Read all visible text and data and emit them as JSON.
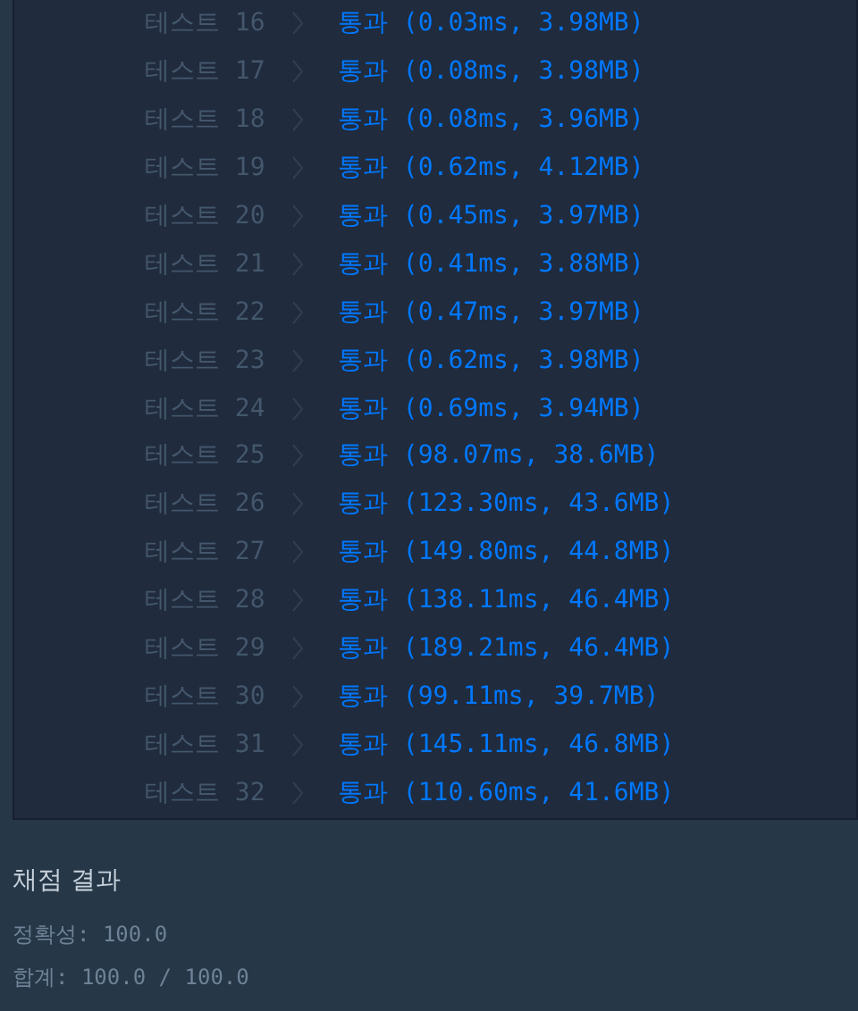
{
  "tests": [
    {
      "label": "테스트 16",
      "result": "통과 (0.03ms, 3.98MB)",
      "passed": true
    },
    {
      "label": "테스트 17",
      "result": "통과 (0.08ms, 3.98MB)",
      "passed": true
    },
    {
      "label": "테스트 18",
      "result": "통과 (0.08ms, 3.96MB)",
      "passed": true
    },
    {
      "label": "테스트 19",
      "result": "통과 (0.62ms, 4.12MB)",
      "passed": true
    },
    {
      "label": "테스트 20",
      "result": "통과 (0.45ms, 3.97MB)",
      "passed": true
    },
    {
      "label": "테스트 21",
      "result": "통과 (0.41ms, 3.88MB)",
      "passed": true
    },
    {
      "label": "테스트 22",
      "result": "통과 (0.47ms, 3.97MB)",
      "passed": true
    },
    {
      "label": "테스트 23",
      "result": "통과 (0.62ms, 3.98MB)",
      "passed": true
    },
    {
      "label": "테스트 24",
      "result": "통과 (0.69ms, 3.94MB)",
      "passed": true
    },
    {
      "label": "테스트 25",
      "result": "통과 (98.07ms, 38.6MB)",
      "passed": true
    },
    {
      "label": "테스트 26",
      "result": "통과 (123.30ms, 43.6MB)",
      "passed": true
    },
    {
      "label": "테스트 27",
      "result": "통과 (149.80ms, 44.8MB)",
      "passed": true
    },
    {
      "label": "테스트 28",
      "result": "통과 (138.11ms, 46.4MB)",
      "passed": true
    },
    {
      "label": "테스트 29",
      "result": "통과 (189.21ms, 46.4MB)",
      "passed": true
    },
    {
      "label": "테스트 30",
      "result": "통과 (99.11ms, 39.7MB)",
      "passed": true
    },
    {
      "label": "테스트 31",
      "result": "통과 (145.11ms, 46.8MB)",
      "passed": true
    },
    {
      "label": "테스트 32",
      "result": "통과 (110.60ms, 41.6MB)",
      "passed": true
    }
  ],
  "summary": {
    "title": "채점 결과",
    "lines": [
      "정확성: 100.0",
      "합계: 100.0 / 100.0"
    ]
  }
}
